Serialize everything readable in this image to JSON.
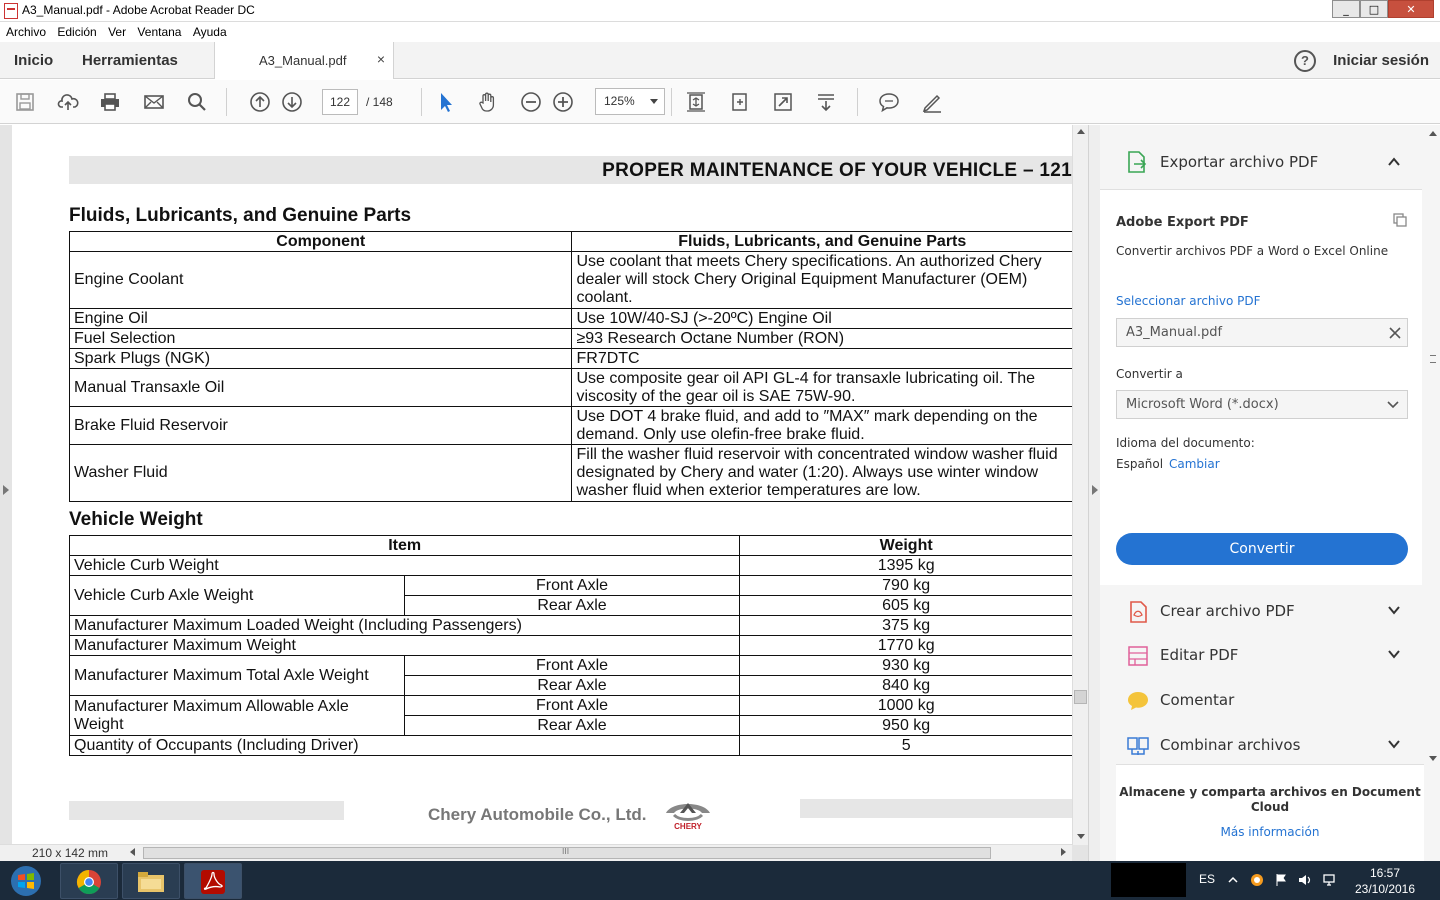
{
  "window": {
    "title": "A3_Manual.pdf - Adobe Acrobat Reader DC",
    "min": "_",
    "max": "□",
    "close": "✕"
  },
  "menu": [
    "Archivo",
    "Edición",
    "Ver",
    "Ventana",
    "Ayuda"
  ],
  "tabs": {
    "home": "Inicio",
    "tools": "Herramientas",
    "doc": "A3_Manual.pdf",
    "doc_close": "×",
    "help": "?",
    "signin": "Iniciar sesión"
  },
  "toolbar": {
    "page_current": "122",
    "page_total": "/ 148",
    "zoom": "125%"
  },
  "doc": {
    "header": "PROPER MAINTENANCE OF YOUR VEHICLE   –   121",
    "section1": "Fluids, Lubricants, and Genuine Parts",
    "table1": {
      "headers": [
        "Component",
        "Fluids, Lubricants, and Genuine Parts"
      ],
      "rows": [
        [
          "Engine Coolant",
          "Use coolant that meets Chery specifications. An authorized Chery dealer will stock Chery Original Equipment Manufacturer (OEM) coolant."
        ],
        [
          "Engine Oil",
          "Use 10W/40-SJ (>-20ºC) Engine Oil"
        ],
        [
          "Fuel Selection",
          "≥93 Research Octane Number (RON)"
        ],
        [
          "Spark Plugs (NGK)",
          "FR7DTC"
        ],
        [
          "Manual Transaxle Oil",
          "Use composite gear oil API GL-4 for transaxle lubricating oil. The viscosity of the gear oil is SAE 75W-90."
        ],
        [
          "Brake Fluid Reservoir",
          "Use DOT 4 brake fluid, and add to ″MAX″ mark depending on the demand. Only use olefin-free brake fluid."
        ],
        [
          "Washer Fluid",
          "Fill the washer fluid reservoir with concentrated window washer fluid designated by Chery and water (1:20). Always use winter window washer fluid when exterior temperatures are low."
        ]
      ]
    },
    "section2": "Vehicle Weight",
    "table2": {
      "headers": [
        "Item",
        "Weight"
      ],
      "curb": [
        "Vehicle Curb Weight",
        "1395 kg"
      ],
      "axle": [
        "Vehicle Curb Axle Weight",
        "Front Axle",
        "790 kg",
        "Rear Axle",
        "605 kg"
      ],
      "loaded": [
        "Manufacturer Maximum Loaded Weight (Including Passengers)",
        "375 kg"
      ],
      "max": [
        "Manufacturer Maximum Weight",
        "1770 kg"
      ],
      "total_axle": [
        "Manufacturer Maximum Total Axle Weight",
        "Front Axle",
        "930 kg",
        "Rear Axle",
        "840 kg"
      ],
      "allow_axle": [
        "Manufacturer Maximum Allowable Axle Weight",
        "Front Axle",
        "1000 kg",
        "Rear Axle",
        "950 kg"
      ],
      "occupants": [
        "Quantity of Occupants (Including Driver)",
        "5"
      ]
    },
    "footer": "Chery Automobile Co., Ltd.",
    "logo_text": "CHERY",
    "dims": "210 x 142 mm",
    "hscroll_grip": "III"
  },
  "panel": {
    "export_title": "Exportar archivo PDF",
    "service_title": "Adobe Export PDF",
    "service_desc": "Convertir archivos PDF a Word o Excel Online",
    "select_label": "Seleccionar archivo PDF",
    "selected_file": "A3_Manual.pdf",
    "convert_to_label": "Convertir a",
    "convert_to_value": "Microsoft Word (*.docx)",
    "lang_label": "Idioma del documento:",
    "lang_value": "Español",
    "lang_change": "Cambiar",
    "convert_button": "Convertir",
    "tools": [
      "Crear archivo PDF",
      "Editar PDF",
      "Comentar",
      "Combinar archivos"
    ],
    "note": "Almacene y comparta archivos en Document Cloud",
    "more": "Más información"
  },
  "taskbar": {
    "lang": "ES",
    "time": "16:57",
    "date": "23/10/2016"
  }
}
